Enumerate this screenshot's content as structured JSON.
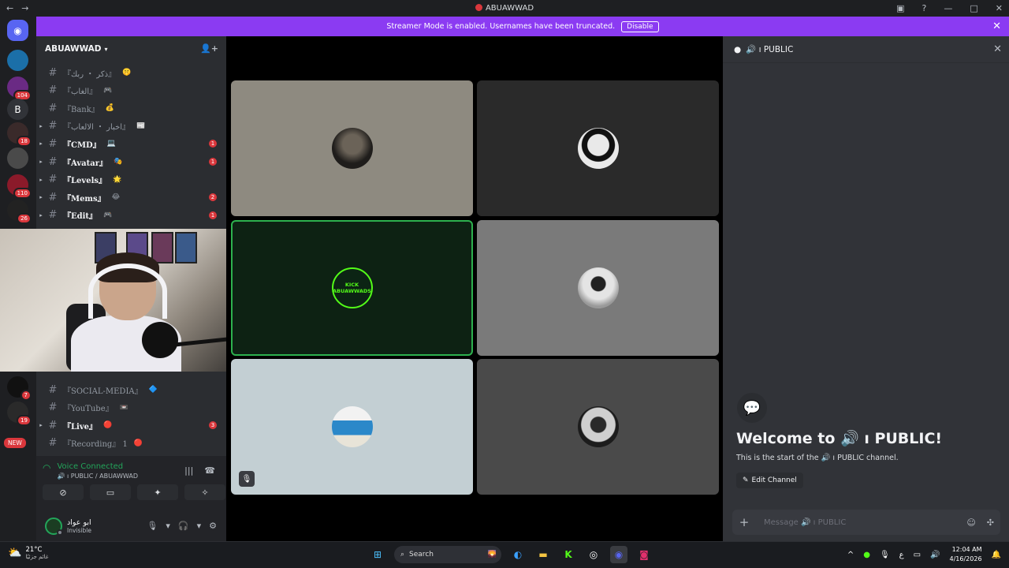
{
  "window": {
    "title": "ABUAWWAD"
  },
  "banner": {
    "text": "Streamer Mode is enabled. Usernames have been truncated.",
    "button": "Disable"
  },
  "guilds": [
    {
      "label": "",
      "badge": ""
    },
    {
      "label": "",
      "badge": "104"
    },
    {
      "label": "B",
      "badge": ""
    },
    {
      "label": "",
      "badge": "18"
    },
    {
      "label": "",
      "badge": ""
    },
    {
      "label": "",
      "badge": "110"
    },
    {
      "label": "",
      "badge": "26"
    },
    {
      "label": "",
      "badge": "7"
    },
    {
      "label": "",
      "badge": "19"
    }
  ],
  "guild_new_pill": "NEW",
  "server": {
    "name": "ABUAWWAD"
  },
  "channels": [
    {
      "name": "『ذكر ・ ربك』",
      "emoji": "🤫",
      "unread": "",
      "bright": false,
      "expand": false
    },
    {
      "name": "『الغاب』",
      "emoji": "🎮",
      "unread": "",
      "bright": false,
      "expand": false
    },
    {
      "name": "『Bank』",
      "emoji": "💰",
      "unread": "",
      "bright": false,
      "expand": false
    },
    {
      "name": "『اخبار ・ الالعاب』",
      "emoji": "📰",
      "unread": "",
      "bright": false,
      "expand": true
    },
    {
      "name": "『CMD』",
      "emoji": "💻",
      "unread": "1",
      "bright": true,
      "expand": true
    },
    {
      "name": "『Avatar』",
      "emoji": "🎭",
      "unread": "1",
      "bright": true,
      "expand": true
    },
    {
      "name": "『Levels』",
      "emoji": "🌟",
      "unread": "",
      "bright": true,
      "expand": true
    },
    {
      "name": "『Mems』",
      "emoji": "😂",
      "unread": "2",
      "bright": true,
      "expand": true
    },
    {
      "name": "『Edit』",
      "emoji": "🎮",
      "unread": "1",
      "bright": true,
      "expand": true
    }
  ],
  "lower_channels": [
    {
      "name": "『SOCIAL-MEDIA』",
      "emoji": "🔷",
      "unread": "",
      "bright": false,
      "expand": false
    },
    {
      "name": "『YouTube』",
      "emoji": "📼",
      "unread": "",
      "bright": false,
      "expand": false
    },
    {
      "name": "『Live』",
      "emoji": "🔴",
      "unread": "3",
      "bright": true,
      "expand": true
    },
    {
      "name": "『Recording』 1",
      "emoji": "🔴",
      "unread": "",
      "bright": false,
      "expand": false
    }
  ],
  "voice": {
    "status": "Voice Connected",
    "channel": "🔊 ı PUBLIC / ABUAWWAD"
  },
  "user": {
    "name": "ابو عواد",
    "status": "Invisible"
  },
  "tiles": [
    "",
    "",
    "KICK ABUAWWADS",
    "",
    "",
    ""
  ],
  "chat": {
    "header": "🔊 ı PUBLIC",
    "welcome": "Welcome to 🔊 ı PUBLIC!",
    "sub": "This is the start of the 🔊 ı PUBLIC channel.",
    "edit": "Edit Channel",
    "placeholder": "Message 🔊 ı PUBLIC"
  },
  "taskbar": {
    "temp": "21°C",
    "weather_desc": "غائم جزئيًا",
    "search": "Search",
    "lang": "ع",
    "time": "12:04 AM",
    "date": "4/16/2026"
  }
}
